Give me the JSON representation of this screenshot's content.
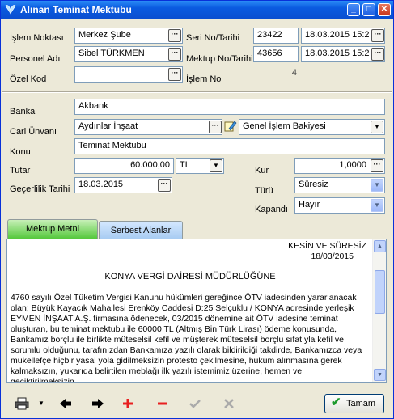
{
  "window": {
    "title": "Alınan Teminat Mektubu",
    "controls": {
      "minimize": "_",
      "maximize": "□",
      "close": "✕"
    }
  },
  "header": {
    "islem_noktasi_label": "İşlem Noktası",
    "islem_noktasi_value": "Merkez Şube",
    "personel_adi_label": "Personel Adı",
    "personel_adi_value": "Sibel TÜRKMEN",
    "ozel_kod_label": "Özel Kod",
    "ozel_kod_value": "",
    "seri_no_label": "Seri No/Tarihi",
    "seri_no_value": "23422",
    "seri_tarih_value": "18.03.2015 15:2",
    "mektup_no_label": "Mektup No/Tarihi",
    "mektup_no_value": "43656",
    "mektup_tarih_value": "18.03.2015 15:2",
    "islem_no_label": "İşlem No",
    "islem_no_value": "4"
  },
  "details": {
    "banka_label": "Banka",
    "banka_value": "Akbank",
    "cari_unvani_label": "Cari Ünvanı",
    "cari_unvani_value": "Aydınlar İnşaat",
    "bakiye_value": "Genel İşlem Bakiyesi",
    "konu_label": "Konu",
    "konu_value": "Teminat Mektubu",
    "tutar_label": "Tutar",
    "tutar_value": "60.000,00",
    "currency_value": "TL",
    "kur_label": "Kur",
    "kur_value": "1,0000",
    "gecerlilik_label": "Geçerlilik Tarihi",
    "gecerlilik_value": "18.03.2015",
    "turu_label": "Türü",
    "turu_value": "Süresiz",
    "kapandi_label": "Kapandı",
    "kapandi_value": "Hayır"
  },
  "tabs": [
    {
      "label": "Mektup Metni"
    },
    {
      "label": "Serbest Alanlar"
    }
  ],
  "letter": {
    "header_line1": "KESİN VE SÜRESİZ",
    "header_line2": "18/03/2015",
    "recipient": "KONYA VERGİ DAİRESİ MÜDÜRLÜĞÜNE",
    "body": "4760 sayılı Özel Tüketim Vergisi Kanunu hükümleri gereğince ÖTV iadesinden yararlanacak olan; Büyük Kayacık Mahallesi Erenköy Caddesi D:25 Selçuklu / KONYA adresinde yerleşik EYMEN İNŞAAT A.Ş. firmasına ödenecek, 03/2015 dönemine ait ÖTV iadesine teminat oluşturan, bu teminat mektubu ile 60000 TL (Altmış Bin Türk Lirası) ödeme konusunda, Bankamız borçlu ile birlikte müteselsil kefil ve müşterek müteselsil borçlu sıfatıyla kefil ve sorumlu olduğunu, tarafınızdan Bankamıza yazılı olarak bildirildiği takdirde, Bankamızca veya mükellefçe hiçbir yasal yola gidilmeksizin protesto çekilmesine, hüküm alınmasına gerek kalmaksızın, yukarıda belirtilen meblağı ilk yazılı istemimiz üzerine, hemen ve geciktirilmeksizin,"
  },
  "toolbar": {
    "print_icon": "printer-icon",
    "dropdown_icon": "chevron-down-icon",
    "prev_icon": "arrow-left-icon",
    "next_icon": "arrow-right-icon",
    "add_icon": "plus-icon",
    "remove_icon": "minus-icon",
    "confirm_icon": "check-icon",
    "cancel_icon": "cross-icon",
    "ok_label": "Tamam"
  }
}
